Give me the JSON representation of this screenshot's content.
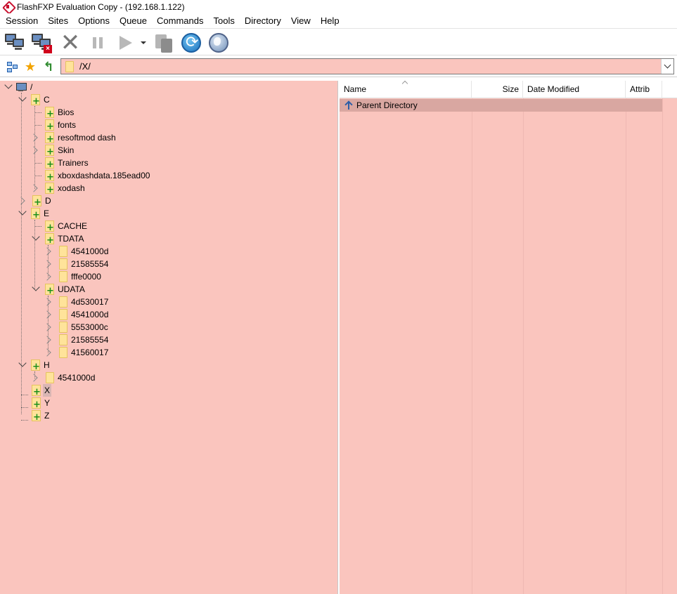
{
  "window": {
    "title": "FlashFXP Evaluation Copy - (192.168.1.122)"
  },
  "menu": [
    "Session",
    "Sites",
    "Options",
    "Queue",
    "Commands",
    "Tools",
    "Directory",
    "View",
    "Help"
  ],
  "toolbar": {
    "buttons": [
      "connect-icon",
      "disconnect-icon",
      "abort-icon",
      "pause-icon",
      "transfer-icon",
      "transfer-dropdown-icon",
      "transfer-selected-icon",
      "refresh-icon",
      "globe-icon"
    ]
  },
  "path": {
    "value": "/X/"
  },
  "tree": {
    "root": "/",
    "nodes": [
      {
        "label": "C"
      },
      {
        "label": "Bios"
      },
      {
        "label": "fonts"
      },
      {
        "label": "resoftmod dash"
      },
      {
        "label": "Skin"
      },
      {
        "label": "Trainers"
      },
      {
        "label": "xboxdashdata.185ead00"
      },
      {
        "label": "xodash"
      },
      {
        "label": "D"
      },
      {
        "label": "E"
      },
      {
        "label": "CACHE"
      },
      {
        "label": "TDATA"
      },
      {
        "label": "4541000d"
      },
      {
        "label": "21585554"
      },
      {
        "label": "fffe0000"
      },
      {
        "label": "UDATA"
      },
      {
        "label": "4d530017"
      },
      {
        "label": "4541000d"
      },
      {
        "label": "5553000c"
      },
      {
        "label": "21585554"
      },
      {
        "label": "41560017"
      },
      {
        "label": "H"
      },
      {
        "label": "4541000d"
      },
      {
        "label": "X"
      },
      {
        "label": "Y"
      },
      {
        "label": "Z"
      }
    ]
  },
  "filelist": {
    "columns": [
      "Name",
      "Size",
      "Date Modified",
      "Attrib"
    ],
    "rows": [
      {
        "name": "Parent Directory"
      }
    ]
  },
  "colors": {
    "pane_bg": "#fac5be",
    "selected_row": "#d9a7a1",
    "selected_tree": "#d9b6b3"
  }
}
